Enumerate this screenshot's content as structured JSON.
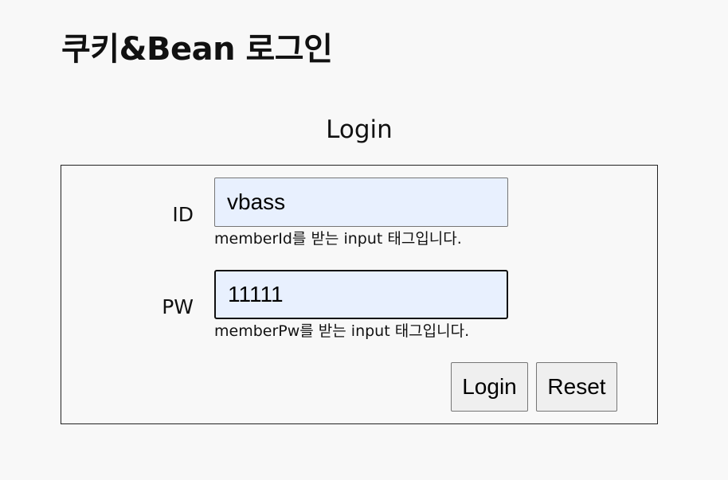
{
  "page": {
    "title": "쿠키&Bean 로그인"
  },
  "form": {
    "heading": "Login",
    "id_label": "ID",
    "id_value": "vbass",
    "id_hint": "memberId를 받는 input 태그입니다.",
    "pw_label": "PW",
    "pw_value": "11111",
    "pw_hint": "memberPw를 받는 input 태그입니다.",
    "login_button": "Login",
    "reset_button": "Reset"
  }
}
